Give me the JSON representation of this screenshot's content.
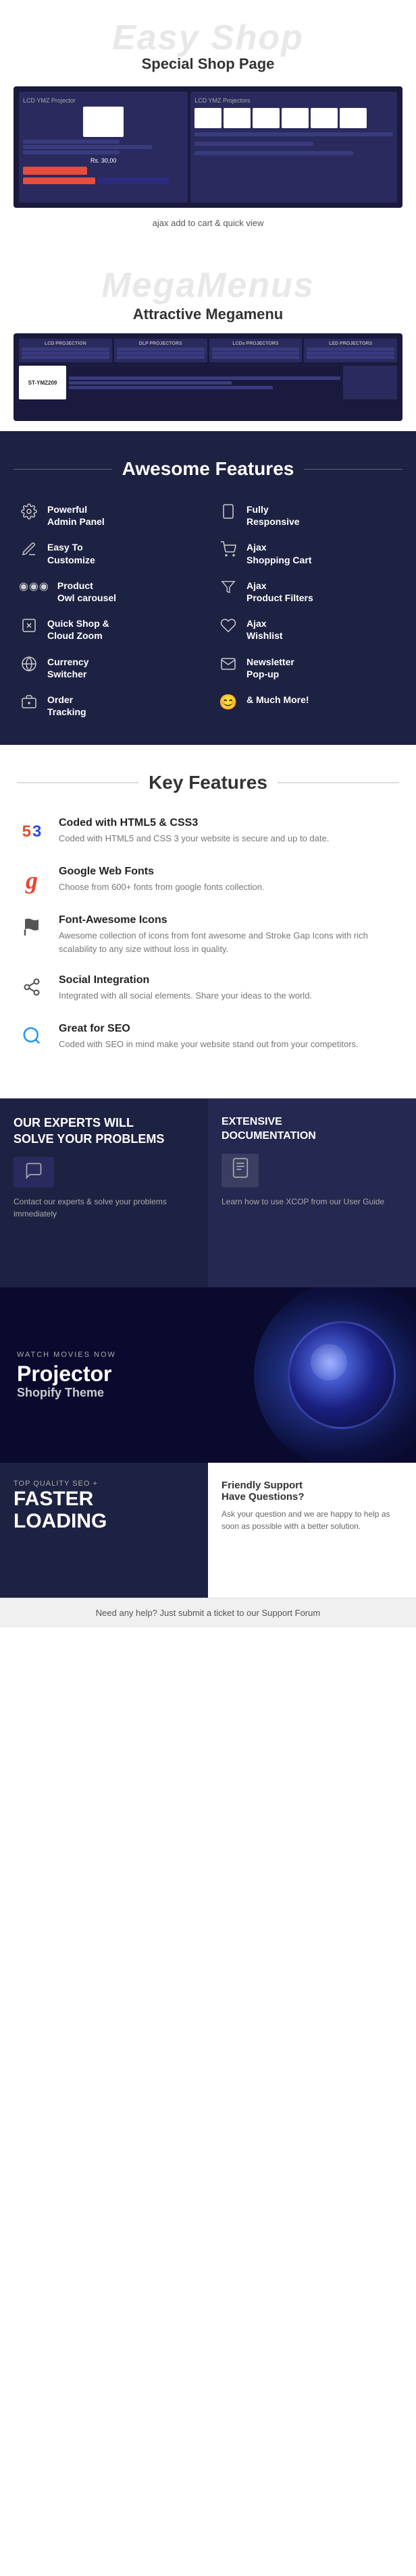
{
  "easy_shop": {
    "bg_title": "Easy Shop",
    "subtitle": "Special Shop Page",
    "ajax_caption": "ajax add to\ncart &\nquick view",
    "screenshot_label": "LCD YMZ Projector"
  },
  "mega_menus": {
    "bg_title": "MegaMenus",
    "subtitle": "Attractive Megamenu",
    "product_label": "ST-YMZ209"
  },
  "awesome_features": {
    "title": "Awesome Features",
    "items": [
      {
        "icon": "⚙",
        "text": "Powerful\nAdmin Panel"
      },
      {
        "icon": "📱",
        "text": "Fully\nResponsive"
      },
      {
        "icon": "✂",
        "text": "Easy To\nCustomize"
      },
      {
        "icon": "🛒",
        "text": "Ajax\nShopping Cart"
      },
      {
        "icon": "◉◉◉",
        "text": "Product\nOwl carousel"
      },
      {
        "icon": "▽",
        "text": "Ajax\nProduct Filters"
      },
      {
        "icon": "🔍+",
        "text": "Quick Shop &\nCloud Zoom"
      },
      {
        "icon": "♥",
        "text": "Ajax\nWishlist"
      },
      {
        "icon": "🌐",
        "text": "Currency\nSwitcher"
      },
      {
        "icon": "✉",
        "text": "Newsletter\nPop-up"
      },
      {
        "icon": "📦",
        "text": "Order\nTracking"
      },
      {
        "icon": "😊",
        "text": "& Much More!"
      }
    ]
  },
  "key_features": {
    "title": "Key Features",
    "items": [
      {
        "icon_type": "html5css3",
        "title": "Coded with HTML5 & CSS3",
        "desc": "Coded with HTML5 and CSS 3 your website is secure and up to date."
      },
      {
        "icon_type": "google",
        "title": "Google Web Fonts",
        "desc": "Choose from 600+ fonts from google fonts collection."
      },
      {
        "icon_type": "flag",
        "title": "Font-Awesome Icons",
        "desc": "Awesome collection of icons from font awesome and Stroke Gap Icons with rich scalability to any size without loss in quality."
      },
      {
        "icon_type": "share",
        "title": "Social Integration",
        "desc": "Integrated with all social elements. Share your ideas to the world."
      },
      {
        "icon_type": "search",
        "title": "Great for SEO",
        "desc": "Coded with SEO in mind make your website stand out from your competitors."
      }
    ]
  },
  "experts": {
    "title": "OUR EXPERTS WILL\nsolve your problems",
    "icon": "💬",
    "desc": "Contact our experts & solve your problems immediately"
  },
  "documentation": {
    "title": "EXTENSIVE\nDocumentation",
    "icon": "📄",
    "desc": "Learn how to use XCOP from our User Guide"
  },
  "projector": {
    "watch_label": "WATCH MOVIES NOW",
    "title": "Projector",
    "subtitle": "Shopify Theme"
  },
  "seo_loading": {
    "quality_label": "Top Quality SEO +",
    "heading": "FASTER\nLOADING"
  },
  "support": {
    "title": "Friendly Support\nHave Questions?",
    "desc": "Ask your question and we are happy to help as soon as possible with a better solution."
  },
  "footer": {
    "text": "Need any help? Just submit a ticket to our Support Forum"
  }
}
